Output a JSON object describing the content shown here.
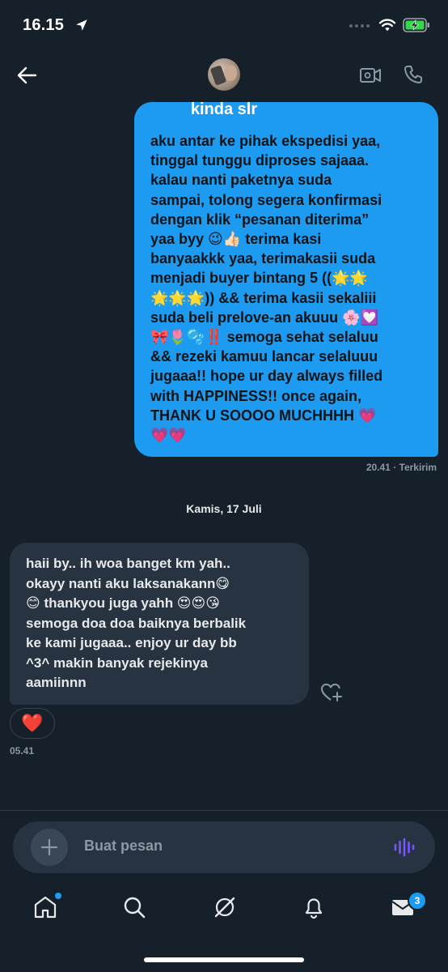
{
  "status_bar": {
    "time": "16.15"
  },
  "header": {
    "contact_name": "kinda slr"
  },
  "messages": {
    "outgoing": {
      "text": "aku antar ke pihak ekspedisi yaa,\ntinggal tunggu diproses sajaaa.\nkalau nanti paketnya suda\nsampai, tolong segera konfirmasi\ndengan klik “pesanan diterima”\nyaa byy 😉👍🏻 terima kasi\nbanyaakkk yaa, terimakasii suda\nmenjadi buyer bintang 5 ((🌟🌟\n🌟🌟🌟)) && terima kasii sekaliii\nsuda beli prelove-an akuuu 🌸💟\n🎀🌷🫧‼️ semoga sehat selaluu\n&& rezeki kamuu lancar selaluuu\njugaaa!! hope ur day always filled\nwith HAPPINESS!! once again,\nTHANK U SOOOO MUCHHHH 💗\n💗💗",
      "meta": "20.41 · Terkirim"
    },
    "date_separator": "Kamis, 17 Juli",
    "incoming": {
      "text": "haii by.. ih woa banget km yah..\nokayy nanti aku laksanakann😋\n😊 thankyou juga yahh 😍😍😘\nsemoga doa doa baiknya berbalik\nke kami jugaaa.. enjoy ur day bb\n^3^ makin banyak rejekinya\naamiinnn",
      "reaction": "❤️",
      "time": "05.41"
    }
  },
  "composer": {
    "placeholder": "Buat pesan"
  },
  "nav": {
    "messages_badge": "3"
  },
  "colors": {
    "background": "#15202b",
    "accent": "#1d9bf0",
    "incoming_bubble": "#273340"
  }
}
